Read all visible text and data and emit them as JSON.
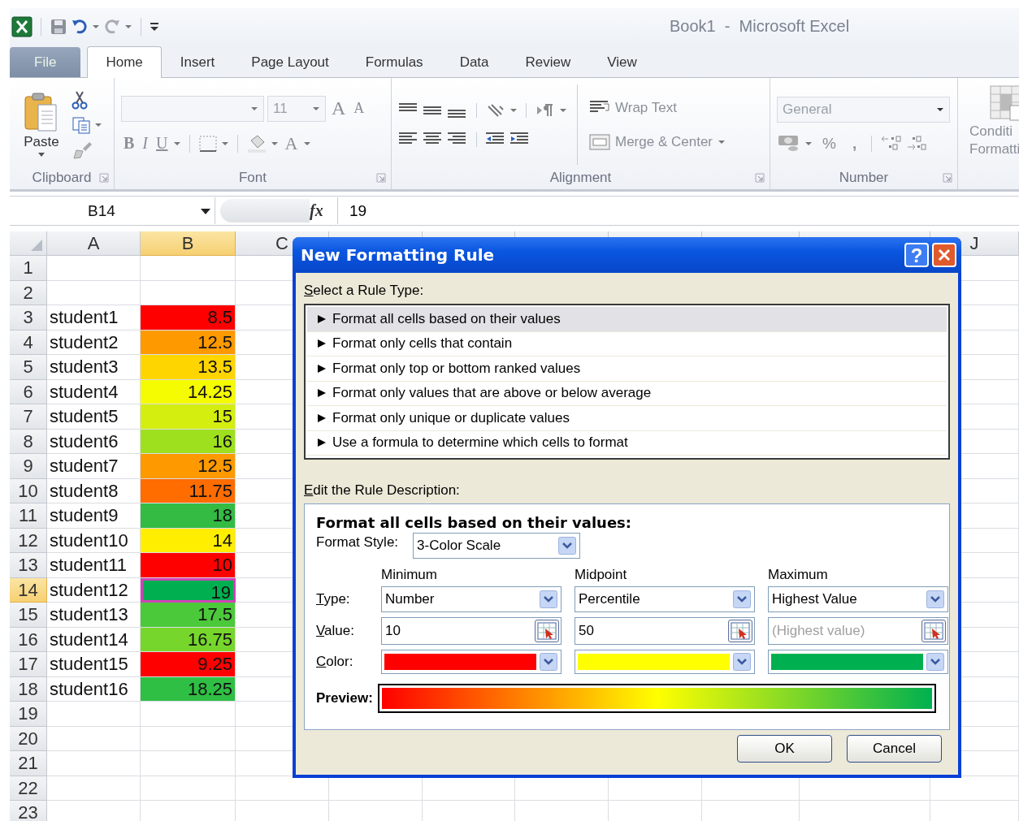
{
  "window": {
    "title": "Book1  -  Microsoft Excel"
  },
  "tabs": [
    {
      "label": "File",
      "kind": "file",
      "selected": false
    },
    {
      "label": "Home",
      "kind": "tab",
      "selected": true
    },
    {
      "label": "Insert",
      "kind": "tab",
      "selected": false
    },
    {
      "label": "Page Layout",
      "kind": "tab",
      "selected": false
    },
    {
      "label": "Formulas",
      "kind": "tab",
      "selected": false
    },
    {
      "label": "Data",
      "kind": "tab",
      "selected": false
    },
    {
      "label": "Review",
      "kind": "tab",
      "selected": false
    },
    {
      "label": "View",
      "kind": "tab",
      "selected": false
    }
  ],
  "ribbon": {
    "clipboard": {
      "paste": "Paste",
      "label": "Clipboard"
    },
    "font": {
      "size": "11",
      "grow": "A",
      "shrink": "A",
      "bold": "B",
      "italic": "I",
      "underline": "U",
      "font_color": "A",
      "label": "Font"
    },
    "alignment": {
      "wrap": "Wrap Text",
      "merge": "Merge & Center",
      "label": "Alignment"
    },
    "number": {
      "format": "General",
      "percent": "%",
      "comma": ",",
      "label": "Number"
    },
    "styles": {
      "conditional_formatting": [
        "Conditi",
        "Formatti"
      ]
    }
  },
  "formula_bar": {
    "name_box": "B14",
    "fx": "fx",
    "value": "19"
  },
  "sheet": {
    "columns": [
      {
        "label": "A",
        "selected": false
      },
      {
        "label": "B",
        "selected": true
      },
      {
        "label": "C",
        "selected": false
      },
      {
        "label": "J",
        "selected": false
      }
    ],
    "rows": [
      {
        "number": "1",
        "selected": false
      },
      {
        "number": "2",
        "selected": false
      },
      {
        "number": "3",
        "selected": false,
        "name": "student1",
        "score": "8.5",
        "color": "#ff0000"
      },
      {
        "number": "4",
        "selected": false,
        "name": "student2",
        "score": "12.5",
        "color": "#ff9900"
      },
      {
        "number": "5",
        "selected": false,
        "name": "student3",
        "score": "13.5",
        "color": "#ffd500"
      },
      {
        "number": "6",
        "selected": false,
        "name": "student4",
        "score": "14.25",
        "color": "#f5fb00"
      },
      {
        "number": "7",
        "selected": false,
        "name": "student5",
        "score": "15",
        "color": "#d4ee10"
      },
      {
        "number": "8",
        "selected": false,
        "name": "student6",
        "score": "16",
        "color": "#9ee01e"
      },
      {
        "number": "9",
        "selected": false,
        "name": "student7",
        "score": "12.5",
        "color": "#ff9900"
      },
      {
        "number": "10",
        "selected": false,
        "name": "student8",
        "score": "11.75",
        "color": "#ff6c00"
      },
      {
        "number": "11",
        "selected": false,
        "name": "student9",
        "score": "18",
        "color": "#33bb44"
      },
      {
        "number": "12",
        "selected": false,
        "name": "student10",
        "score": "14",
        "color": "#ffee00"
      },
      {
        "number": "13",
        "selected": false,
        "name": "student11",
        "score": "10",
        "color": "#ff0000"
      },
      {
        "number": "14",
        "selected": true,
        "name": "student12",
        "score": "19",
        "color": "#00b050"
      },
      {
        "number": "15",
        "selected": false,
        "name": "student13",
        "score": "17.5",
        "color": "#4cc93a"
      },
      {
        "number": "16",
        "selected": false,
        "name": "student14",
        "score": "16.75",
        "color": "#77d62c"
      },
      {
        "number": "17",
        "selected": false,
        "name": "student15",
        "score": "9.25",
        "color": "#ff0000"
      },
      {
        "number": "18",
        "selected": false,
        "name": "student16",
        "score": "18.25",
        "color": "#2fbf44"
      },
      {
        "number": "19",
        "selected": false
      },
      {
        "number": "20",
        "selected": false
      },
      {
        "number": "21",
        "selected": false
      },
      {
        "number": "22",
        "selected": false
      },
      {
        "number": "23",
        "selected": false
      }
    ]
  },
  "dialog": {
    "title": "New Formatting Rule",
    "help": "?",
    "rule_type_label": "Select a Rule Type:",
    "rule_types": [
      {
        "label": "Format all cells based on their values",
        "selected": true
      },
      {
        "label": "Format only cells that contain",
        "selected": false
      },
      {
        "label": "Format only top or bottom ranked values",
        "selected": false
      },
      {
        "label": "Format only values that are above or below average",
        "selected": false
      },
      {
        "label": "Format only unique or duplicate values",
        "selected": false
      },
      {
        "label": "Use a formula to determine which cells to format",
        "selected": false
      }
    ],
    "description_label": "Edit the Rule Description:",
    "heading": "Format all cells based on their values:",
    "format_style_label": "Format Style:",
    "format_style": "3-Color Scale",
    "row_labels": [
      "Type:",
      "Value:",
      "Color:"
    ],
    "points": [
      {
        "name": "Minimum",
        "type": "Number",
        "value": "10",
        "color": "#ff0000"
      },
      {
        "name": "Midpoint",
        "type": "Percentile",
        "value": "50",
        "color": "#ffff00"
      },
      {
        "name": "Maximum",
        "type": "Highest Value",
        "placeholder": "(Highest value)",
        "color": "#00b050"
      }
    ],
    "preview_label": "Preview:",
    "buttons": [
      "OK",
      "Cancel"
    ]
  }
}
